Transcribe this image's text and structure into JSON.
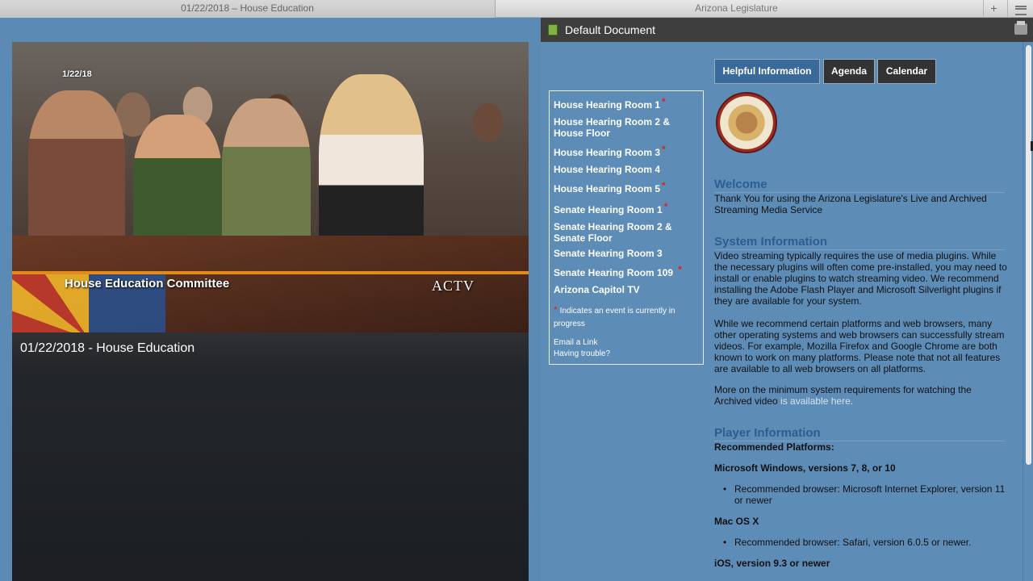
{
  "tabs": {
    "left": "01/22/2018 – House Education",
    "right": "Arizona Legislature",
    "plus": "+"
  },
  "video": {
    "date_stamp": "1/22/18",
    "committee": "House Education Committee",
    "channel": "ACTV"
  },
  "player": {
    "title": "01/22/2018 - House Education"
  },
  "panel": {
    "title": "Default Document"
  },
  "nav": {
    "items": [
      {
        "label": "House Hearing Room 1",
        "live": true
      },
      {
        "label": "House Hearing Room 2 & House Floor",
        "live": false
      },
      {
        "label": "House Hearing Room 3",
        "live": true
      },
      {
        "label": "House Hearing Room 4",
        "live": false
      },
      {
        "label": "House Hearing Room 5",
        "live": true
      },
      {
        "label": "Senate Hearing Room 1",
        "live": true
      },
      {
        "label": "Senate Hearing Room 2 & Senate Floor",
        "live": false
      },
      {
        "label": "Senate Hearing Room 3",
        "live": false
      },
      {
        "label": "Senate Hearing Room 109",
        "live": true
      },
      {
        "label": "Arizona Capitol TV",
        "live": false
      }
    ],
    "star": "*",
    "note": "Indicates an event is currently in progress",
    "email_link": "Email a Link",
    "trouble_link": "Having trouble?"
  },
  "info_tabs": {
    "helpful": "Helpful Information",
    "agenda": "Agenda",
    "calendar": "Calendar"
  },
  "welcome": {
    "heading": "Welcome",
    "text": "Thank You for using the Arizona Legislature's Live and Archived Streaming Media Service"
  },
  "system": {
    "heading": "System Information",
    "p1": "Video streaming typically requires the use of media plugins. While the necessary plugins will often come pre-installed, you may need to install or enable plugins to watch streaming video. We recommend installing the Adobe Flash Player and Microsoft Silverlight plugins if they are available for your system.",
    "p2": "While we recommend certain platforms and web browsers, many other operating systems and web browsers can successfully stream videos. For example, Mozilla Firefox and Google Chrome are both known to work on many platforms. Please note that not all features are available to all web browsers on all platforms.",
    "p3_prefix": "More on the minimum system requirements for watching the Archived video ",
    "p3_link": "is available here."
  },
  "player_info": {
    "heading": "Player Information",
    "recommended": "Recommended Platforms:",
    "windows": "Microsoft Windows, versions 7, 8, or 10",
    "windows_browser": "Recommended browser: Microsoft Internet Explorer, version 11 or newer",
    "mac": "Mac OS X",
    "mac_browser": "Recommended browser: Safari, version 6.0.5 or newer.",
    "ios": "iOS, version 9.3 or newer"
  }
}
